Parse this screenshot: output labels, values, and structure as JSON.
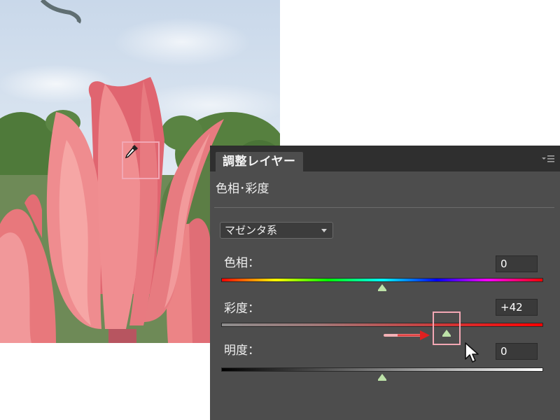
{
  "panel": {
    "tab_label": "調整レイヤー",
    "menu_icon": "panel-menu-icon",
    "adjustment_title": "色相･彩度",
    "range_select": {
      "value": "マゼンタ系"
    },
    "sliders": [
      {
        "label": "色相：",
        "value": "0",
        "level": 0
      },
      {
        "label": "彩度：",
        "value": "+42",
        "level": 42
      },
      {
        "label": "明度：",
        "value": "0",
        "level": 0
      }
    ]
  },
  "photo": {
    "subject": "pink tulips against cloudy sky",
    "tool_icon": "eyedropper-icon"
  },
  "colors": {
    "panel_bg": "#4d4d4d",
    "highlight": "#f2a7b4",
    "thumb": "#bde2a8",
    "arrow": "#e04040"
  }
}
